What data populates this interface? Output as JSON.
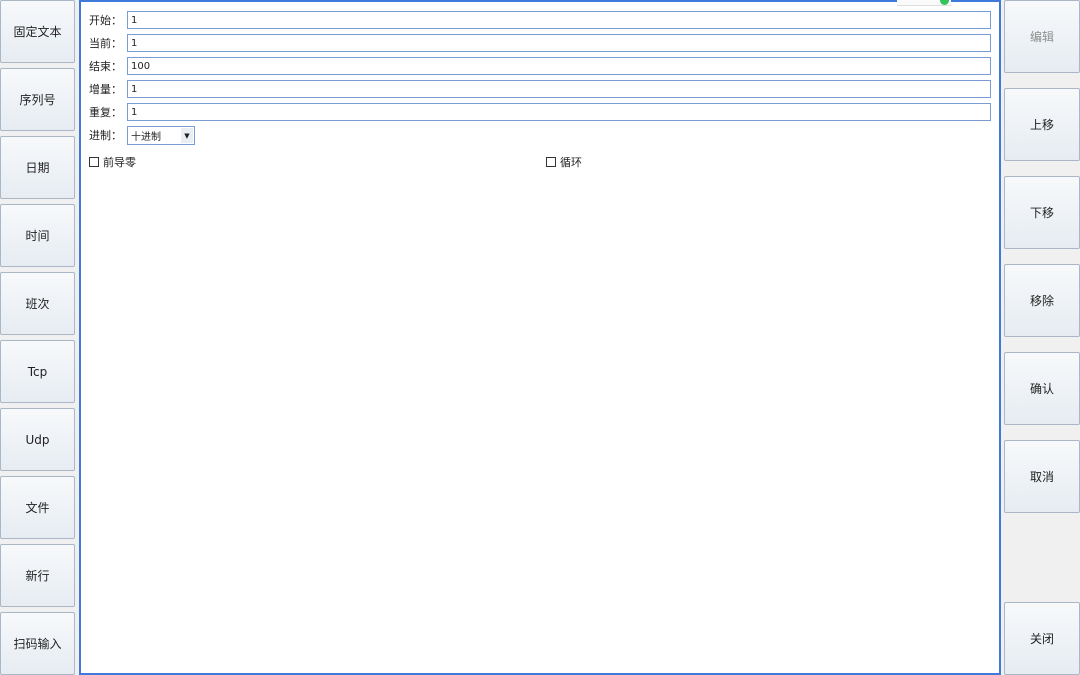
{
  "left_toolbar": {
    "buttons": [
      "固定文本",
      "序列号",
      "日期",
      "时间",
      "班次",
      "Tcp",
      "Udp",
      "文件",
      "新行",
      "扫码输入"
    ]
  },
  "form": {
    "start_label": "开始：",
    "start_value": "1",
    "current_label": "当前：",
    "current_value": "1",
    "end_label": "结束：",
    "end_value": "100",
    "increment_label": "增量：",
    "increment_value": "1",
    "repeat_label": "重复：",
    "repeat_value": "1",
    "radix_label": "进制：",
    "radix_value": "十进制",
    "leading_zero_label": "前导零",
    "leading_zero_checked": false,
    "loop_label": "循环",
    "loop_checked": false
  },
  "right_toolbar": {
    "edit": "编辑",
    "move_up": "上移",
    "move_down": "下移",
    "remove": "移除",
    "confirm": "确认",
    "cancel": "取消",
    "close": "关闭"
  },
  "colors": {
    "panel_border": "#3f79d9",
    "field_border": "#7a9cd3",
    "button_border": "#a9b7c6"
  }
}
